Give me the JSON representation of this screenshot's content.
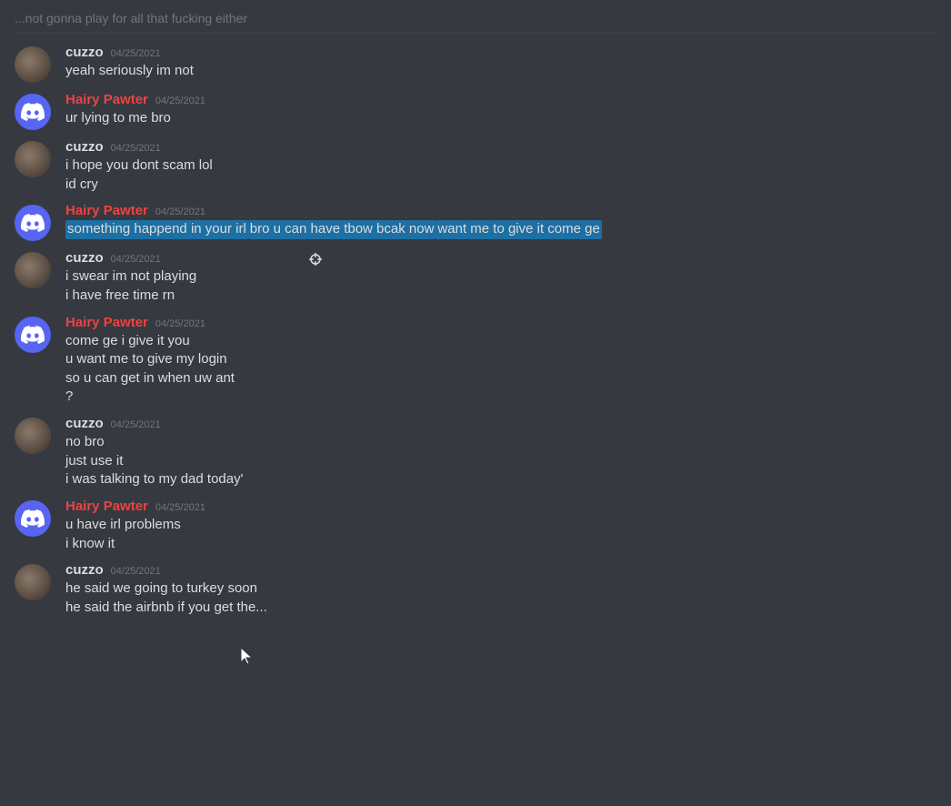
{
  "messages": [
    {
      "id": "top-partial",
      "type": "partial",
      "text": "...not gonna play for all that fucking either"
    },
    {
      "id": "msg1",
      "type": "group",
      "author": "cuzzo",
      "authorType": "user",
      "timestamp": "04/25/2021",
      "lines": [
        "yeah seriously im not"
      ]
    },
    {
      "id": "msg2",
      "type": "group",
      "author": "Hairy Pawter",
      "authorType": "discord",
      "timestamp": "04/25/2021",
      "lines": [
        "ur lying to me bro"
      ]
    },
    {
      "id": "msg3",
      "type": "group",
      "author": "cuzzo",
      "authorType": "user",
      "timestamp": "04/25/2021",
      "lines": [
        "i hope you dont scam lol",
        "id cry"
      ]
    },
    {
      "id": "msg4",
      "type": "group",
      "author": "Hairy Pawter",
      "authorType": "discord",
      "timestamp": "04/25/2021",
      "lines": [
        {
          "text": "something happend in your irl",
          "highlight": true
        },
        {
          "text": "bro u can have tbow bcak now",
          "highlight": true
        },
        {
          "text": "want me to give it come ge",
          "highlight": true
        }
      ]
    },
    {
      "id": "msg5",
      "type": "group",
      "author": "cuzzo",
      "authorType": "user",
      "timestamp": "04/25/2021",
      "lines": [
        "i swear im not playing",
        "i have free time rn"
      ]
    },
    {
      "id": "msg6",
      "type": "group",
      "author": "Hairy Pawter",
      "authorType": "discord",
      "timestamp": "04/25/2021",
      "lines": [
        "come ge i give it you",
        "u want me to give my login",
        "so u can get in when uw ant",
        "?"
      ]
    },
    {
      "id": "msg7",
      "type": "group",
      "author": "cuzzo",
      "authorType": "user",
      "timestamp": "04/25/2021",
      "lines": [
        "no bro",
        "just use it",
        "i was talking to my dad today'"
      ]
    },
    {
      "id": "msg8",
      "type": "group",
      "author": "Hairy Pawter",
      "authorType": "discord",
      "timestamp": "04/25/2021",
      "lines": [
        "u have irl problems",
        "i know it"
      ]
    },
    {
      "id": "msg9",
      "type": "group",
      "author": "cuzzo",
      "authorType": "user",
      "timestamp": "04/25/2021",
      "lines": [
        "he said we going to turkey soon",
        "he said the airbnb if you get the..."
      ]
    }
  ]
}
